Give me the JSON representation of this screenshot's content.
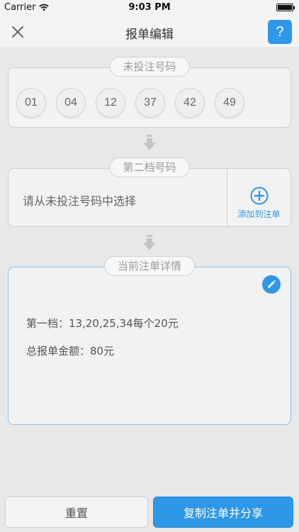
{
  "status_bar": {
    "carrier": "Carrier",
    "time": "9:03 PM"
  },
  "nav": {
    "title": "报单编辑",
    "help_label": "?"
  },
  "unbet_section": {
    "label": "未投注号码",
    "numbers": [
      "01",
      "04",
      "12",
      "37",
      "42",
      "49"
    ]
  },
  "second_section": {
    "label": "第二档号码",
    "placeholder_text": "请从未投注号码中选择",
    "add_label": "添加到注单"
  },
  "detail_section": {
    "label": "当前注单详情",
    "line1": "第一档：13,20,25,34每个20元",
    "line2": "总报单金额：80元"
  },
  "buttons": {
    "reset": "重置",
    "copy_share": "复制注单并分享"
  },
  "colors": {
    "accent": "#2f97e8",
    "background": "#e8e8e8",
    "panel": "#f2f2f2"
  }
}
